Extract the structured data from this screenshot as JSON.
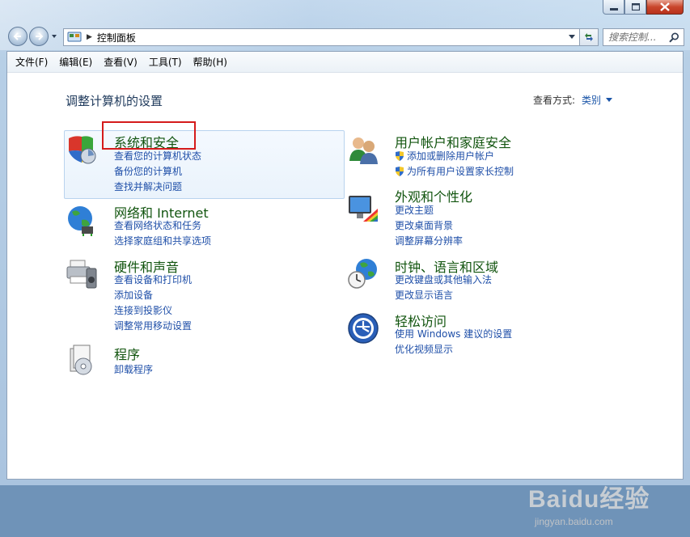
{
  "window": {
    "caption_buttons": [
      "minimize",
      "maximize",
      "close"
    ]
  },
  "address_bar": {
    "path": "控制面板",
    "location_icon": "control-panel-icon"
  },
  "search": {
    "placeholder": "搜索控制..."
  },
  "menu": {
    "items": [
      "文件(F)",
      "编辑(E)",
      "查看(V)",
      "工具(T)",
      "帮助(H)"
    ]
  },
  "page": {
    "title": "调整计算机的设置",
    "view_by_label": "查看方式:",
    "view_by_value": "类别"
  },
  "categories": [
    {
      "title": "系统和安全",
      "icon": "shield-icon",
      "highlighted": true,
      "links": [
        "查看您的计算机状态",
        "备份您的计算机",
        "查找并解决问题"
      ]
    },
    {
      "title": "网络和 Internet",
      "icon": "network-globe-icon",
      "links": [
        "查看网络状态和任务",
        "选择家庭组和共享选项"
      ]
    },
    {
      "title": "硬件和声音",
      "icon": "printer-speaker-icon",
      "links": [
        "查看设备和打印机",
        "添加设备",
        "连接到投影仪",
        "调整常用移动设置"
      ]
    },
    {
      "title": "程序",
      "icon": "programs-cd-icon",
      "links": [
        "卸载程序"
      ]
    },
    {
      "title": "用户帐户和家庭安全",
      "icon": "users-icon",
      "links": [
        "添加或删除用户帐户",
        "为所有用户设置家长控制"
      ]
    },
    {
      "title": "外观和个性化",
      "icon": "monitor-palette-icon",
      "links": [
        "更改主题",
        "更改桌面背景",
        "调整屏幕分辨率"
      ]
    },
    {
      "title": "时钟、语言和区域",
      "icon": "clock-globe-icon",
      "links": [
        "更改键盘或其他输入法",
        "更改显示语言"
      ]
    },
    {
      "title": "轻松访问",
      "icon": "ease-of-access-icon",
      "links": [
        "使用 Windows 建议的设置",
        "优化视频显示"
      ]
    }
  ],
  "watermark": {
    "brand": "Baidu经验",
    "url": "jingyan.baidu.com"
  },
  "colors": {
    "category_title": "#11540e",
    "link": "#1f4fa8",
    "annotation_box": "#d51b1b",
    "close_button": "#c9462c"
  }
}
